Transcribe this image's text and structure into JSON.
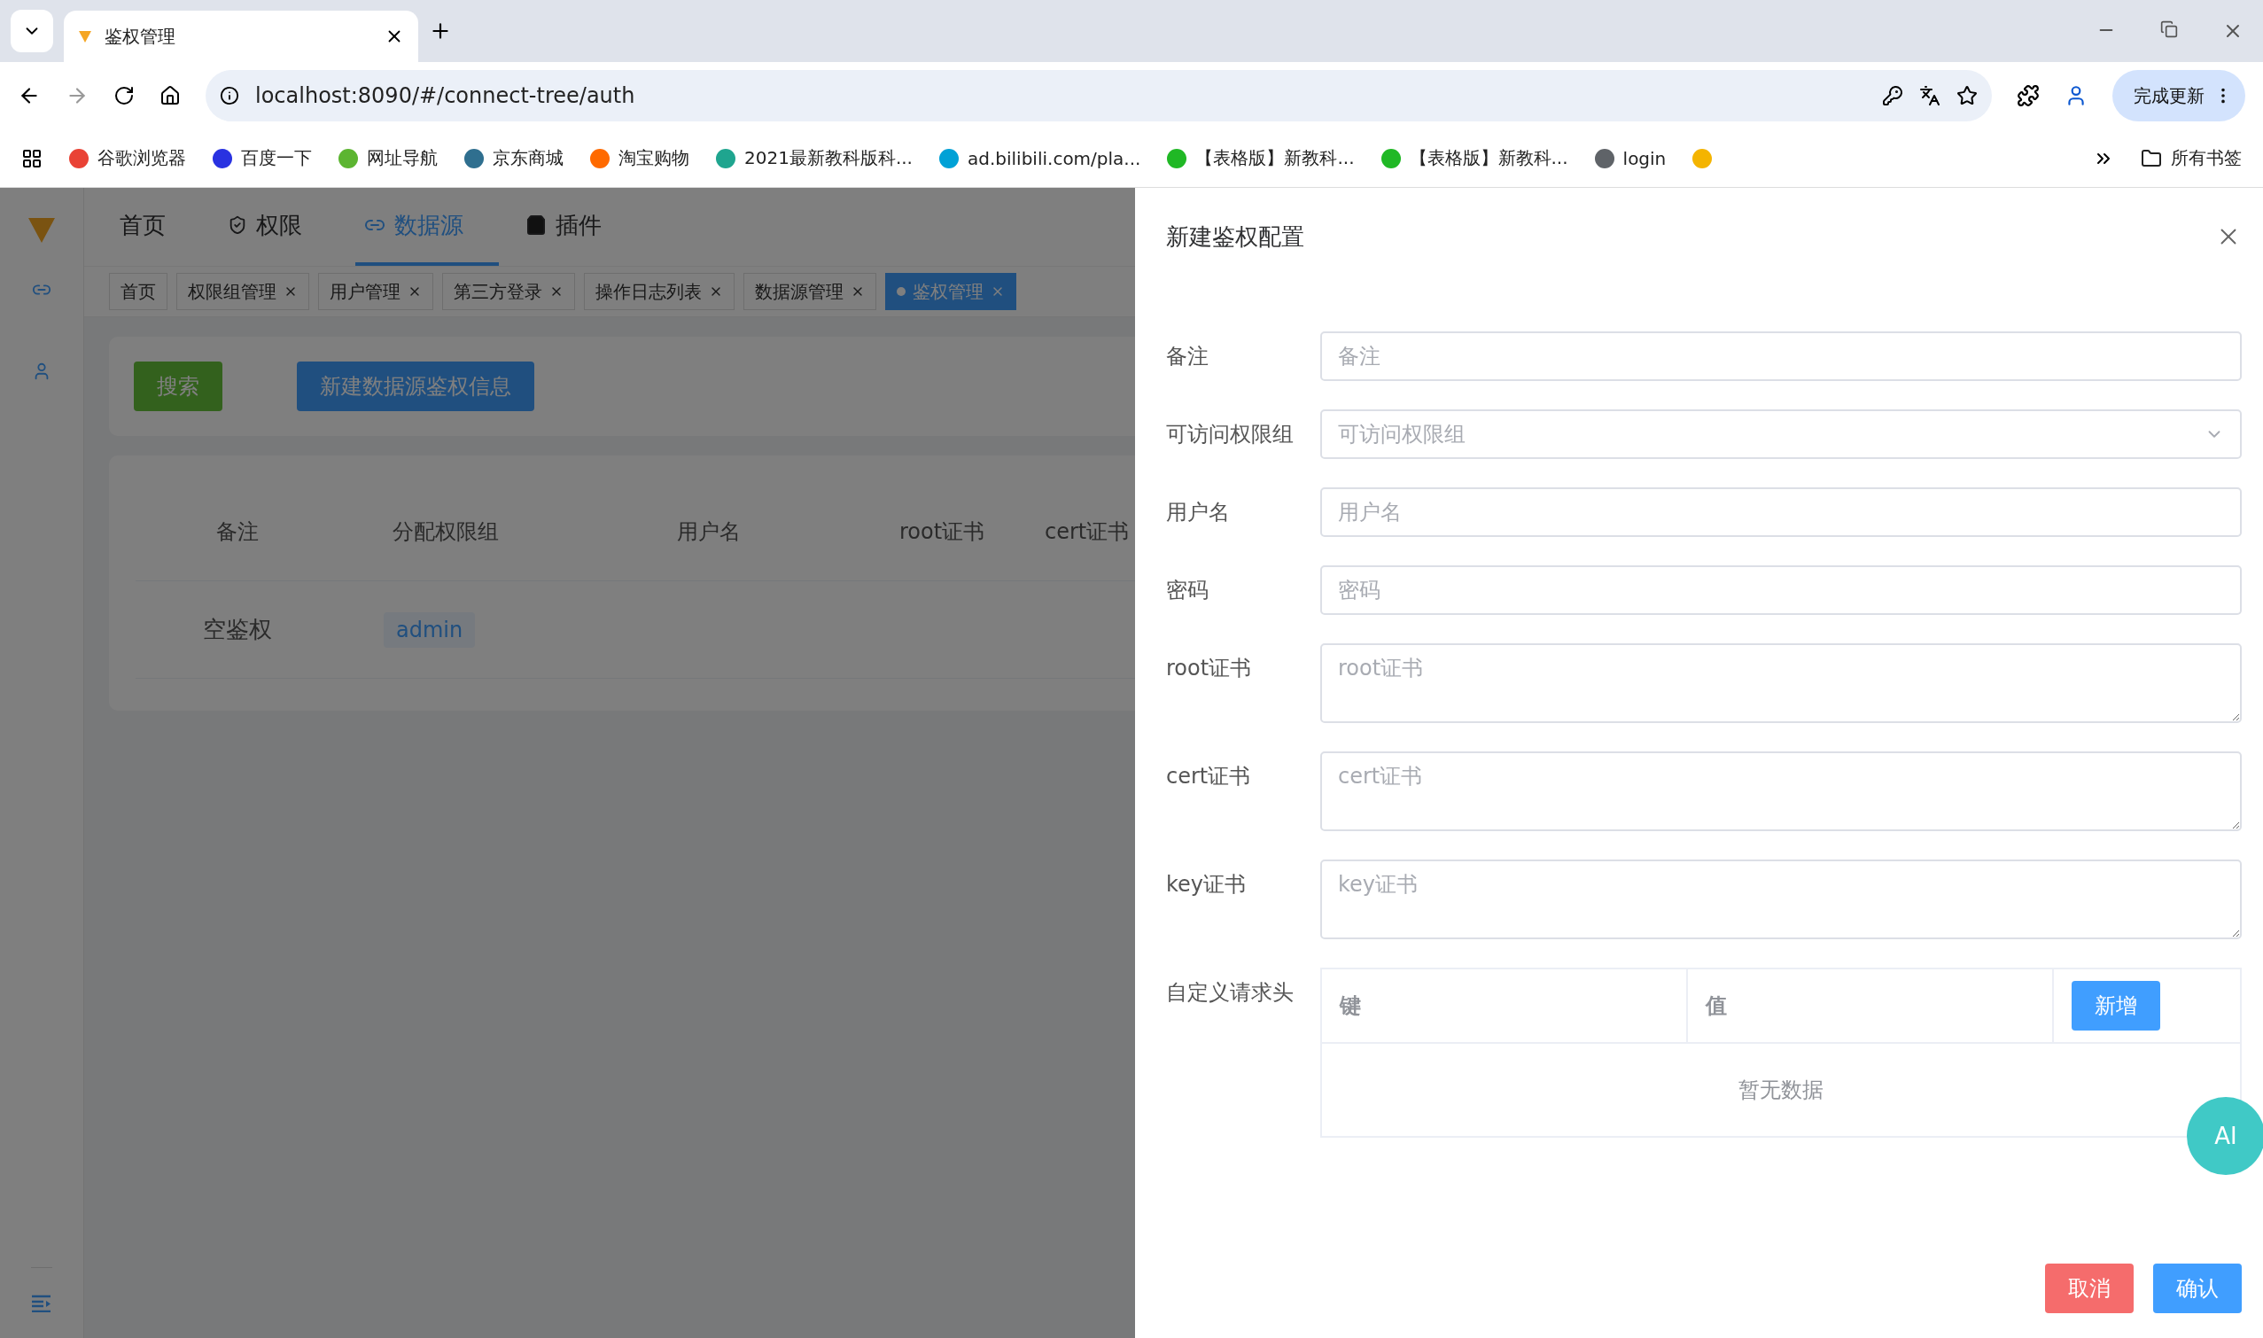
{
  "browser": {
    "tab_title": "鉴权管理",
    "url": "localhost:8090/#/connect-tree/auth",
    "update_button": "完成更新",
    "bookmarks": [
      {
        "label": "谷歌浏览器",
        "color": "#e94235"
      },
      {
        "label": "百度一下",
        "color": "#2932e1"
      },
      {
        "label": "网址导航",
        "color": "#5cb531"
      },
      {
        "label": "京东商城",
        "color": "#2f6f8f"
      },
      {
        "label": "淘宝购物",
        "color": "#ff6a00"
      },
      {
        "label": "2021最新教科版科...",
        "color": "#1fa58f"
      },
      {
        "label": "ad.bilibili.com/pla...",
        "color": "#00a1d6"
      },
      {
        "label": "【表格版】新教科...",
        "color": "#20b825"
      },
      {
        "label": "【表格版】新教科...",
        "color": "#20b825"
      },
      {
        "label": "login",
        "color": "#5f6368"
      },
      {
        "color": "#f4b400"
      }
    ],
    "bookmarks_folder": "所有书签"
  },
  "app": {
    "top_nav": [
      {
        "label": "首页",
        "selected": false
      },
      {
        "label": "权限",
        "selected": false
      },
      {
        "label": "数据源",
        "selected": true
      },
      {
        "label": "插件",
        "selected": false
      }
    ],
    "tags": [
      {
        "label": "首页",
        "selected": false,
        "closable": false
      },
      {
        "label": "权限组管理",
        "selected": false,
        "closable": true
      },
      {
        "label": "用户管理",
        "selected": false,
        "closable": true
      },
      {
        "label": "第三方登录",
        "selected": false,
        "closable": true
      },
      {
        "label": "操作日志列表",
        "selected": false,
        "closable": true
      },
      {
        "label": "数据源管理",
        "selected": false,
        "closable": true
      },
      {
        "label": "鉴权管理",
        "selected": true,
        "closable": true
      }
    ],
    "search_button": "搜索",
    "create_button": "新建数据源鉴权信息",
    "table": {
      "columns": [
        "备注",
        "分配权限组",
        "用户名",
        "root证书",
        "cert证书"
      ],
      "rows": [
        {
          "note": "空鉴权",
          "group": "admin"
        }
      ]
    }
  },
  "drawer": {
    "title": "新建鉴权配置",
    "fields": [
      {
        "label": "备注",
        "placeholder": "备注",
        "kind": "input"
      },
      {
        "label": "可访问权限组",
        "placeholder": "可访问权限组",
        "kind": "select"
      },
      {
        "label": "用户名",
        "placeholder": "用户名",
        "kind": "input"
      },
      {
        "label": "密码",
        "placeholder": "密码",
        "kind": "input"
      },
      {
        "label": "root证书",
        "placeholder": "root证书",
        "kind": "textarea"
      },
      {
        "label": "cert证书",
        "placeholder": "cert证书",
        "kind": "textarea"
      },
      {
        "label": "key证书",
        "placeholder": "key证书",
        "kind": "textarea"
      }
    ],
    "headers": {
      "label": "自定义请求头",
      "columns": [
        "键",
        "值"
      ],
      "add_button": "新增",
      "empty": "暂无数据"
    },
    "cancel_button": "取消",
    "confirm_button": "确认"
  },
  "ai_button": "AI"
}
